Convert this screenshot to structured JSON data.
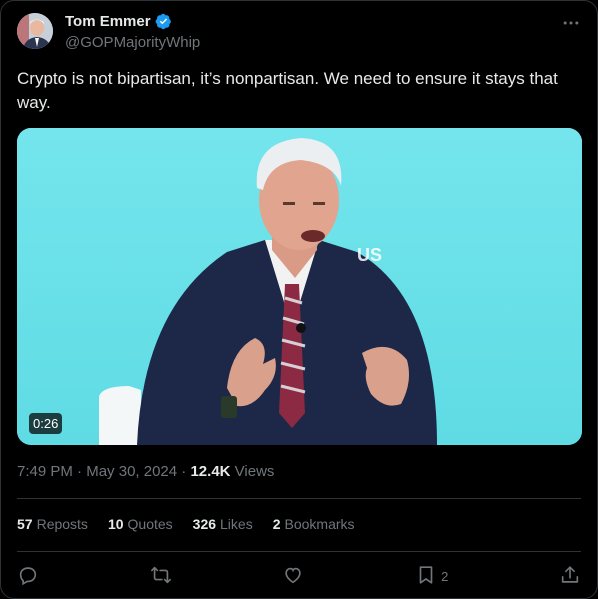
{
  "author": {
    "name": "Tom Emmer",
    "handle": "@GOPMajorityWhip",
    "verified": true
  },
  "tweet": {
    "text": "Crypto is not bipartisan, it’s nonpartisan. We need to ensure it stays that way."
  },
  "media": {
    "type": "video",
    "duration": "0:26",
    "background_color": "#6fe3ea"
  },
  "meta": {
    "time": "7:49 PM",
    "separator": "·",
    "date": "May 30, 2024",
    "views_count": "12.4K",
    "views_label": "Views"
  },
  "stats": {
    "reposts": {
      "count": "57",
      "label": "Reposts"
    },
    "quotes": {
      "count": "10",
      "label": "Quotes"
    },
    "likes": {
      "count": "326",
      "label": "Likes"
    },
    "bookmarks": {
      "count": "2",
      "label": "Bookmarks"
    }
  },
  "actions": {
    "bookmark_count": "2"
  },
  "colors": {
    "background": "#000000",
    "text": "#e7e9ea",
    "muted": "#71767b",
    "divider": "#2f3336",
    "verified": "#1d9bf0"
  },
  "icons": [
    "more-icon",
    "verified-icon",
    "reply-icon",
    "repost-icon",
    "like-icon",
    "bookmark-icon",
    "share-icon"
  ]
}
